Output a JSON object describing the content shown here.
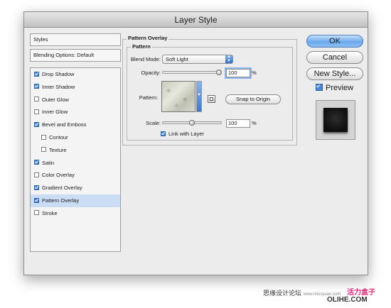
{
  "window": {
    "title": "Layer Style"
  },
  "styles_panel": {
    "header": "Styles",
    "blending_header": "Blending Options: Default",
    "items": [
      {
        "label": "Drop Shadow",
        "checked": true,
        "indent": false,
        "selected": false
      },
      {
        "label": "Inner Shadow",
        "checked": true,
        "indent": false,
        "selected": false
      },
      {
        "label": "Outer Glow",
        "checked": false,
        "indent": false,
        "selected": false
      },
      {
        "label": "Inner Glow",
        "checked": false,
        "indent": false,
        "selected": false
      },
      {
        "label": "Bevel and Emboss",
        "checked": true,
        "indent": false,
        "selected": false
      },
      {
        "label": "Contour",
        "checked": false,
        "indent": true,
        "selected": false
      },
      {
        "label": "Texture",
        "checked": false,
        "indent": true,
        "selected": false
      },
      {
        "label": "Satin",
        "checked": true,
        "indent": false,
        "selected": false
      },
      {
        "label": "Color Overlay",
        "checked": false,
        "indent": false,
        "selected": false
      },
      {
        "label": "Gradient Overlay",
        "checked": true,
        "indent": false,
        "selected": false
      },
      {
        "label": "Pattern Overlay",
        "checked": true,
        "indent": false,
        "selected": true
      },
      {
        "label": "Stroke",
        "checked": false,
        "indent": false,
        "selected": false
      }
    ]
  },
  "pattern_overlay": {
    "group_title": "Pattern Overlay",
    "subgroup_title": "Pattern",
    "blend_mode_label": "Blend Mode:",
    "blend_mode_value": "Soft Light",
    "opacity_label": "Opacity:",
    "opacity_value": "100",
    "opacity_unit": "%",
    "opacity_fraction": 1.0,
    "pattern_label": "Pattern:",
    "snap_button": "Snap to Origin",
    "scale_label": "Scale:",
    "scale_value": "100",
    "scale_unit": "%",
    "scale_fraction": 0.5,
    "link_label": "Link with Layer",
    "link_checked": true
  },
  "buttons": {
    "ok": "OK",
    "cancel": "Cancel",
    "new_style": "New Style...",
    "preview_label": "Preview",
    "preview_checked": true
  },
  "icons": {
    "popup_arrows": "up-down-arrows-icon",
    "pattern_menu": "triangle-down-icon",
    "new_preset": "new-preset-icon"
  },
  "colors": {
    "selection": "#cbdcf5",
    "default_button": "#6aa9ec",
    "checkbox_on": "#4a86d6"
  },
  "watermark": {
    "line1": "思缘设计论坛",
    "line2": "www.missyuan.com",
    "logo_top": "活力盒子",
    "logo_bottom": "OLIHE.COM"
  }
}
